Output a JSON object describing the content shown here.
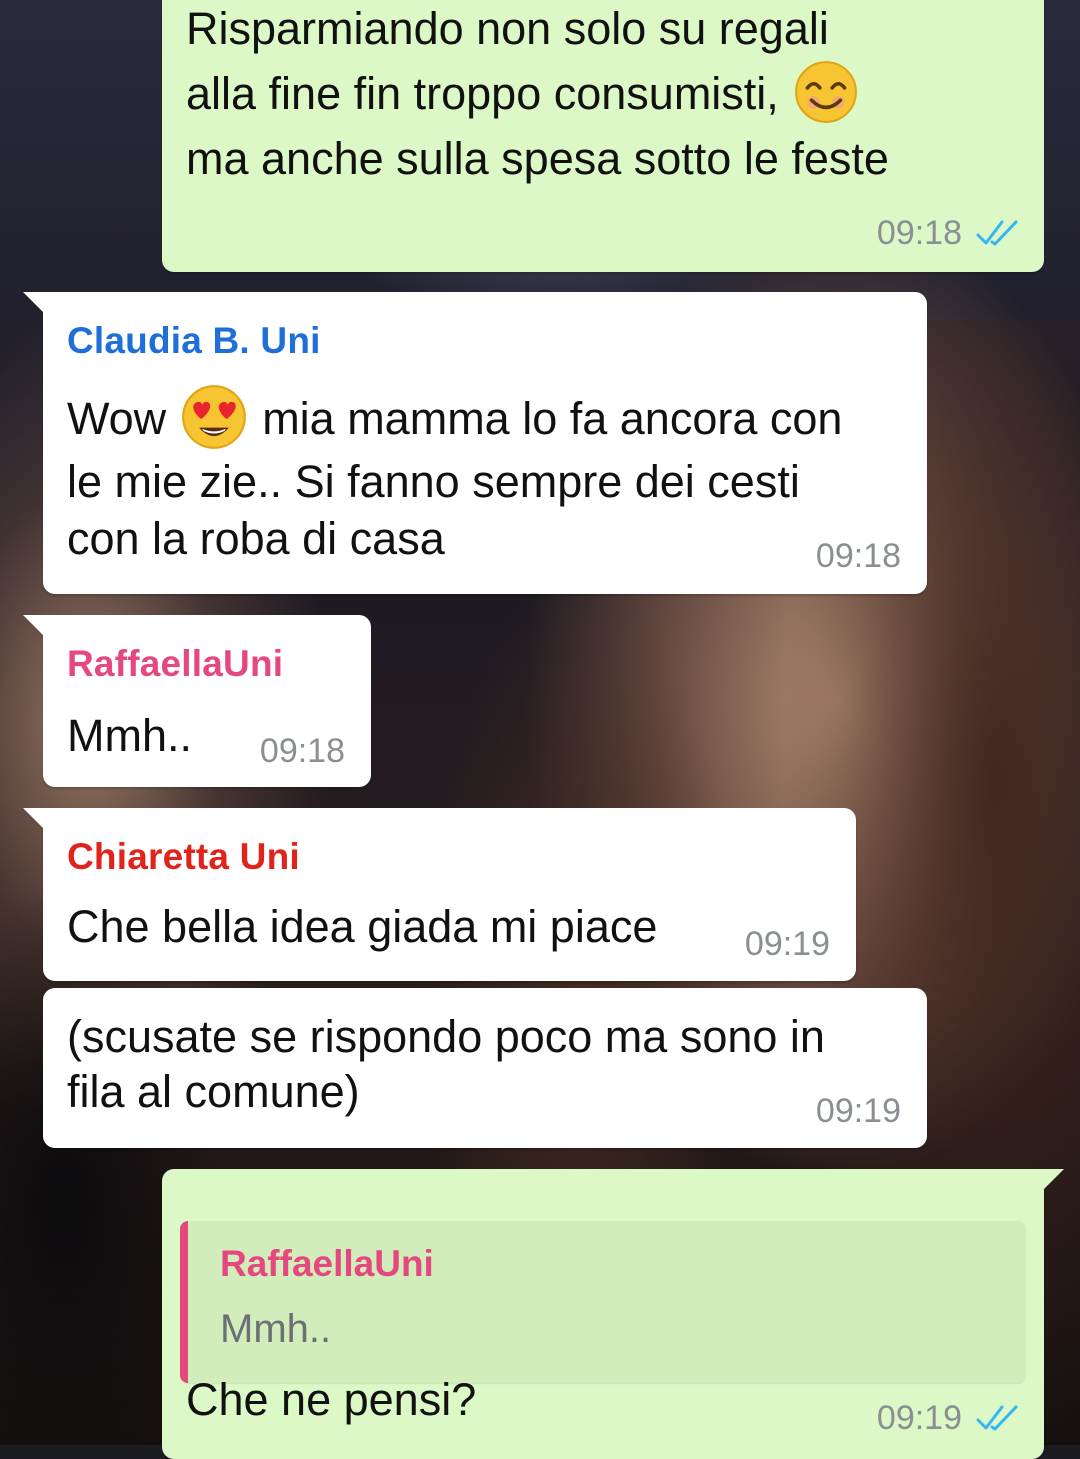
{
  "colors": {
    "incoming_bubble": "#ffffff",
    "outgoing_bubble": "#dcf8c6",
    "read_ticks": "#34b7f1",
    "sender_claudia": "#1e6fd9",
    "sender_raffaella": "#e5487f",
    "sender_chiaretta": "#e0241b"
  },
  "messages": [
    {
      "direction": "out",
      "lines": [
        "Risparmiando non solo su regali",
        "alla fine fin troppo consumisti,",
        "ma anche sulla spesa sotto le feste"
      ],
      "emoji": "smiling-face-icon",
      "time": "09:18",
      "status": "read"
    },
    {
      "direction": "in",
      "sender": "Claudia B. Uni",
      "line1_before": "Wow",
      "line1_after": "mia mamma lo fa ancora con",
      "lines": [
        "le mie zie.. Si fanno sempre dei cesti",
        "con la roba di casa"
      ],
      "emoji": "heart-eyes-icon",
      "time": "09:18"
    },
    {
      "direction": "in",
      "sender": "RaffaellaUni",
      "text": "Mmh..",
      "time": "09:18"
    },
    {
      "direction": "in",
      "sender": "Chiaretta Uni",
      "text": "Che bella idea giada mi piace",
      "time": "09:19"
    },
    {
      "direction": "in",
      "lines": [
        "(scusate se rispondo poco ma sono in",
        "fila al comune)"
      ],
      "time": "09:19"
    },
    {
      "direction": "out",
      "quote": {
        "sender": "RaffaellaUni",
        "text": "Mmh.."
      },
      "text": "Che ne pensi?",
      "time": "09:19",
      "status": "read"
    }
  ]
}
